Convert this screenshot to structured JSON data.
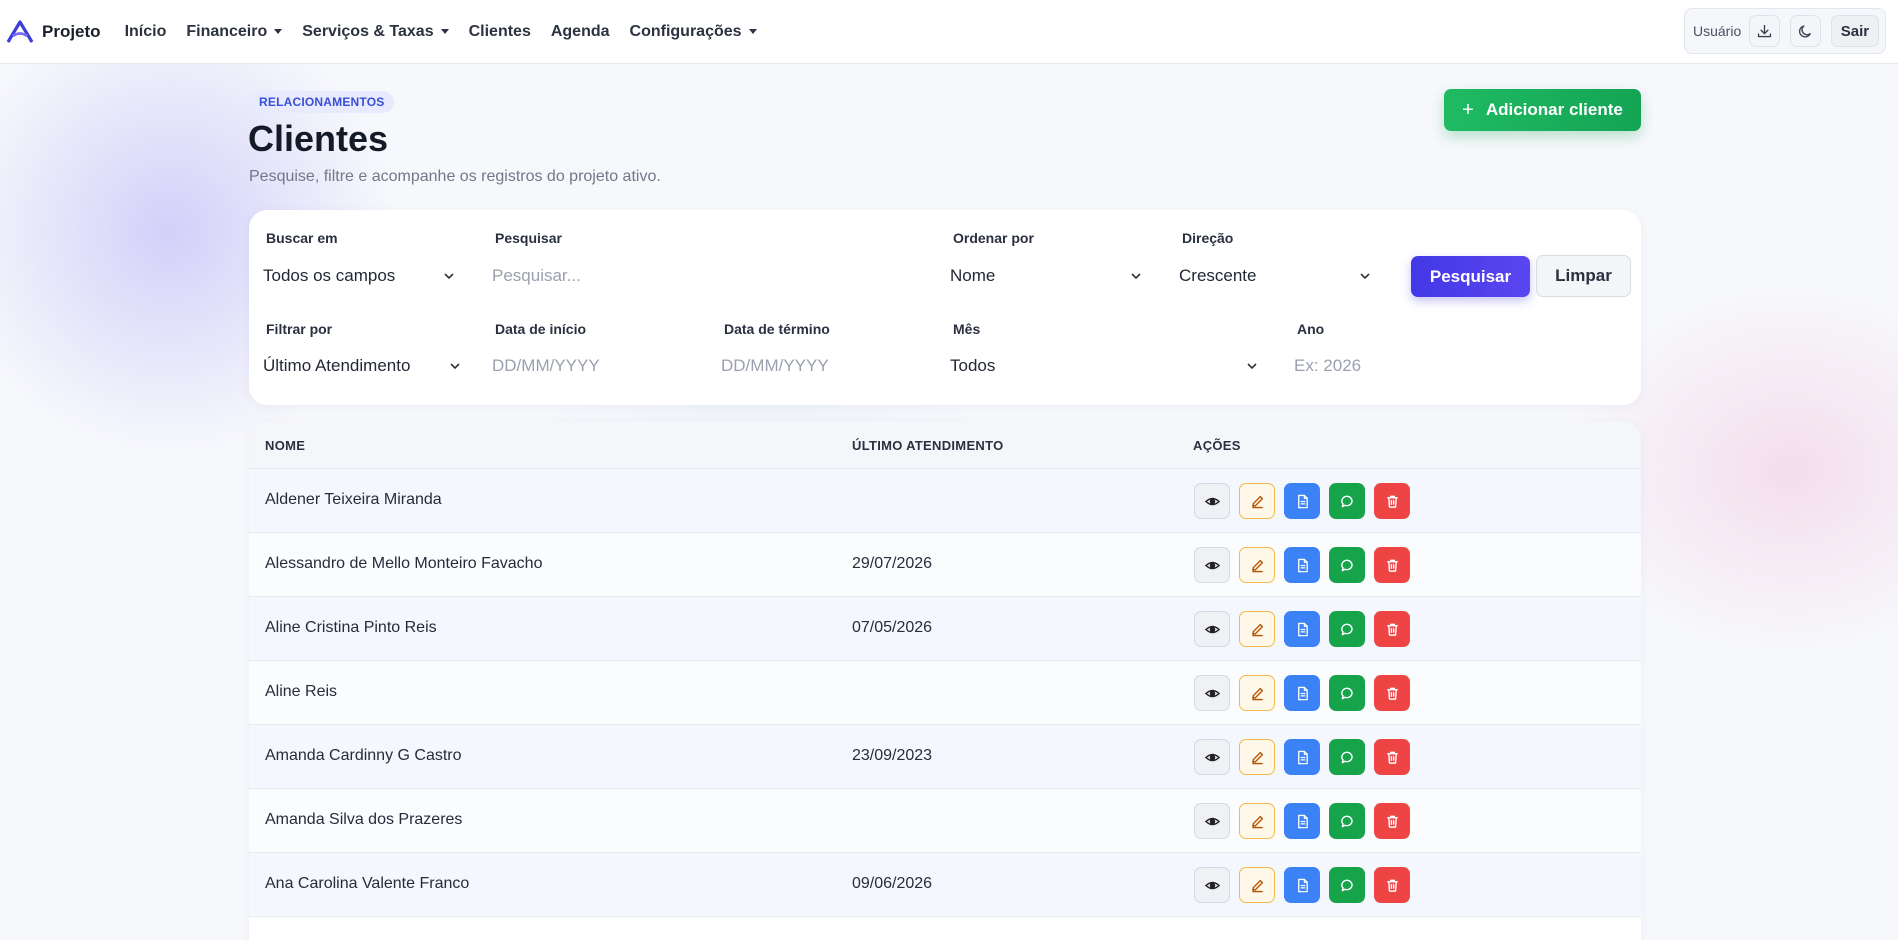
{
  "nav": {
    "brand": "Projeto",
    "items": [
      {
        "label": "Início",
        "dropdown": false
      },
      {
        "label": "Financeiro",
        "dropdown": true
      },
      {
        "label": "Serviços & Taxas",
        "dropdown": true
      },
      {
        "label": "Clientes",
        "dropdown": false
      },
      {
        "label": "Agenda",
        "dropdown": false
      },
      {
        "label": "Configurações",
        "dropdown": true
      }
    ],
    "user_label": "Usuário",
    "logout_label": "Sair"
  },
  "header": {
    "eyebrow": "RELACIONAMENTOS",
    "title": "Clientes",
    "subtitle": "Pesquise, filtre e acompanhe os registros do projeto ativo.",
    "add_button": "Adicionar cliente"
  },
  "filters": {
    "search_in": {
      "label": "Buscar em",
      "value": "Todos os campos"
    },
    "search": {
      "label": "Pesquisar",
      "placeholder": "Pesquisar..."
    },
    "order_by": {
      "label": "Ordenar por",
      "value": "Nome"
    },
    "direction": {
      "label": "Direção",
      "value": "Crescente"
    },
    "search_button": "Pesquisar",
    "clear_button": "Limpar",
    "filter_by": {
      "label": "Filtrar por",
      "value": "Último Atendimento"
    },
    "start_date": {
      "label": "Data de início",
      "placeholder": "DD/MM/YYYY"
    },
    "end_date": {
      "label": "Data de término",
      "placeholder": "DD/MM/YYYY"
    },
    "month": {
      "label": "Mês",
      "value": "Todos"
    },
    "year": {
      "label": "Ano",
      "placeholder": "Ex: 2026"
    }
  },
  "table": {
    "columns": [
      "NOME",
      "ÚLTIMO ATENDIMENTO",
      "AÇÕES"
    ],
    "rows": [
      {
        "name": "Aldener Teixeira Miranda",
        "last": ""
      },
      {
        "name": "Alessandro de Mello Monteiro Favacho",
        "last": "29/07/2026"
      },
      {
        "name": "Aline Cristina Pinto Reis",
        "last": "07/05/2026"
      },
      {
        "name": "Aline Reis",
        "last": ""
      },
      {
        "name": "Amanda Cardinny G Castro",
        "last": "23/09/2023"
      },
      {
        "name": "Amanda Silva dos Prazeres",
        "last": ""
      },
      {
        "name": "Ana Carolina Valente Franco",
        "last": "09/06/2026"
      }
    ],
    "action_icons": [
      "eye-icon",
      "pencil-icon",
      "document-icon",
      "chat-icon",
      "trash-icon"
    ]
  },
  "colors": {
    "primary": "#4338e6",
    "success": "#16a34a",
    "info": "#3b82f6",
    "danger": "#ef4444",
    "warning": "#f3b94a"
  }
}
